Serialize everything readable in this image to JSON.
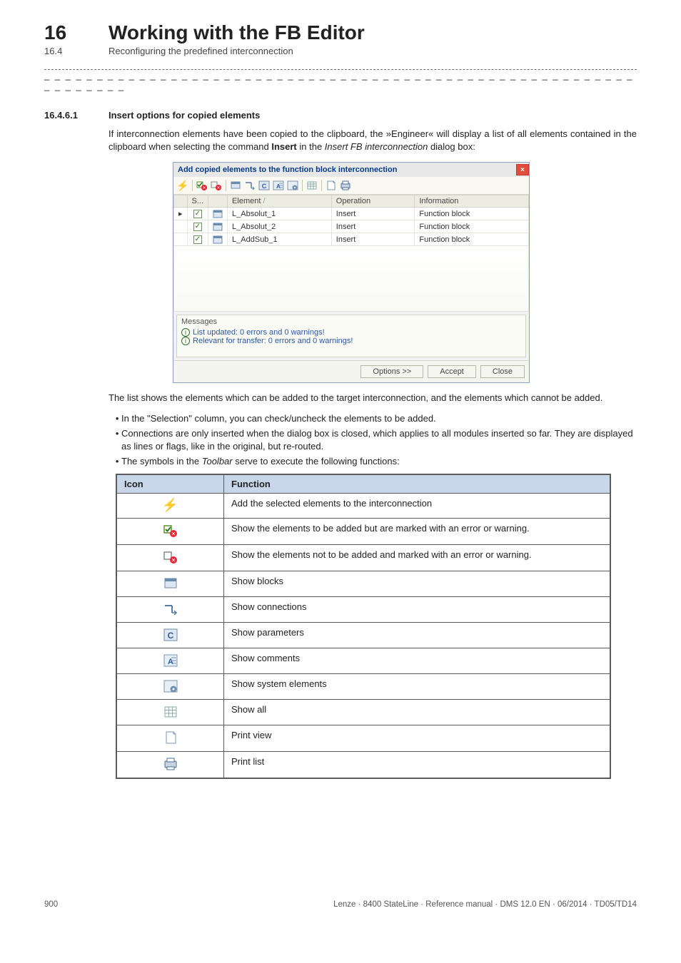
{
  "header": {
    "chapterNumber": "16",
    "chapterTitle": "Working with the FB Editor",
    "sectionNumber": "16.4",
    "sectionTitle": "Reconfiguring the predefined interconnection"
  },
  "section": {
    "num": "16.4.6.1",
    "title": "Insert options for copied elements"
  },
  "body": {
    "p1_a": "If interconnection elements have been copied to the clipboard, the »Engineer« will display a list of all elements contained in the clipboard when selecting the command ",
    "p1_insert": "Insert",
    "p1_b": " in the ",
    "p1_dialog": "Insert FB interconnection",
    "p1_c": " dialog box:",
    "p2": "The list shows the elements which can be added to the target interconnection, and the elements which cannot be added.",
    "li1": "In the \"Selection\" column, you can check/uncheck the elements to be added.",
    "li2": "Connections are only inserted when the dialog box is closed, which applies to all modules inserted so far. They are displayed as lines or flags, like in the original, but re-routed.",
    "li3_a": "The symbols in the ",
    "li3_toolbar": "Toolbar",
    "li3_b": " serve to execute the following functions:"
  },
  "dialog": {
    "title": "Add copied elements to the function block interconnection",
    "cols": {
      "sel": "S...",
      "element": "Element",
      "operation": "Operation",
      "info": "Information"
    },
    "rows": [
      {
        "element": "L_Absolut_1",
        "operation": "Insert",
        "info": "Function block"
      },
      {
        "element": "L_Absolut_2",
        "operation": "Insert",
        "info": "Function block"
      },
      {
        "element": "L_AddSub_1",
        "operation": "Insert",
        "info": "Function block"
      }
    ],
    "messagesLabel": "Messages",
    "msg1": "List updated: 0 errors and 0 warnings!",
    "msg2": "Relevant for transfer: 0 errors and 0 warnings!",
    "btnOptions": "Options >>",
    "btnAccept": "Accept",
    "btnClose": "Close"
  },
  "iconTable": {
    "h1": "Icon",
    "h2": "Function",
    "rows": [
      {
        "name": "bolt-icon",
        "fn": "Add the selected elements to the interconnection"
      },
      {
        "name": "check-warn-icon",
        "fn": "Show the elements to be added but are marked with an error or warning."
      },
      {
        "name": "uncheck-warn-icon",
        "fn": "Show the elements not to be added and marked with an error or warning."
      },
      {
        "name": "blocks-icon",
        "fn": "Show blocks"
      },
      {
        "name": "connections-icon",
        "fn": "Show connections"
      },
      {
        "name": "parameters-icon",
        "fn": "Show parameters"
      },
      {
        "name": "comments-icon",
        "fn": "Show comments"
      },
      {
        "name": "syselem-icon",
        "fn": "Show system elements"
      },
      {
        "name": "showall-icon",
        "fn": "Show all"
      },
      {
        "name": "printview-icon",
        "fn": "Print view"
      },
      {
        "name": "printlist-icon",
        "fn": "Print list"
      }
    ]
  },
  "footer": {
    "pageNum": "900",
    "meta": "Lenze · 8400 StateLine · Reference manual · DMS 12.0 EN · 06/2014 · TD05/TD14"
  }
}
